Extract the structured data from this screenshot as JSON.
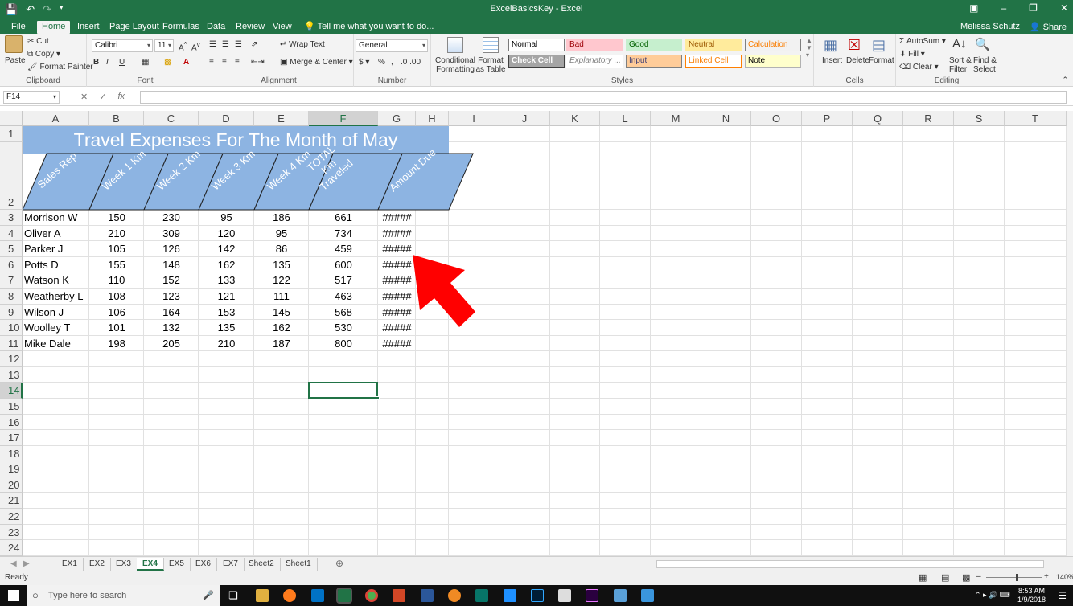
{
  "app": {
    "title": "ExcelBasicsKey - Excel",
    "user": "Melissa Schutz",
    "share": "Share"
  },
  "tabs": [
    "File",
    "Home",
    "Insert",
    "Page Layout",
    "Formulas",
    "Data",
    "Review",
    "View"
  ],
  "tell_me": "Tell me what you want to do...",
  "ribbon": {
    "clipboard": {
      "paste": "Paste",
      "cut": "Cut",
      "copy": "Copy",
      "format_painter": "Format Painter",
      "label": "Clipboard"
    },
    "font": {
      "name": "Calibri",
      "size": "11",
      "label": "Font"
    },
    "alignment": {
      "wrap": "Wrap Text",
      "merge": "Merge & Center",
      "label": "Alignment"
    },
    "number": {
      "format": "General",
      "label": "Number"
    },
    "styles": {
      "conditional": "Conditional Formatting",
      "format_table": "Format as Table",
      "label": "Styles",
      "cells": [
        {
          "name": "Normal",
          "bg": "#ffffff",
          "fg": "#000000",
          "border": "#7a7a7a"
        },
        {
          "name": "Bad",
          "bg": "#ffc7ce",
          "fg": "#9c0006",
          "border": "#ffc7ce"
        },
        {
          "name": "Good",
          "bg": "#c6efce",
          "fg": "#006100",
          "border": "#c6efce"
        },
        {
          "name": "Neutral",
          "bg": "#ffeb9c",
          "fg": "#9c5700",
          "border": "#ffeb9c"
        },
        {
          "name": "Calculation",
          "bg": "#f2f2f2",
          "fg": "#fa7d00",
          "border": "#7f7f7f"
        },
        {
          "name": "Check Cell",
          "bg": "#a5a5a5",
          "fg": "#ffffff",
          "border": "#3f3f3f"
        },
        {
          "name": "Explanatory ...",
          "bg": "#ffffff",
          "fg": "#7f7f7f",
          "border": "#ffffff"
        },
        {
          "name": "Input",
          "bg": "#ffcc99",
          "fg": "#3f3f76",
          "border": "#7f7f7f"
        },
        {
          "name": "Linked Cell",
          "bg": "#ffffff",
          "fg": "#fa7d00",
          "border": "#ff8001"
        },
        {
          "name": "Note",
          "bg": "#ffffcc",
          "fg": "#000000",
          "border": "#b2b2b2"
        }
      ]
    },
    "cells": {
      "insert": "Insert",
      "delete": "Delete",
      "format": "Format",
      "label": "Cells"
    },
    "editing": {
      "autosum": "AutoSum",
      "fill": "Fill",
      "clear": "Clear",
      "sort": "Sort & Filter",
      "find": "Find & Select",
      "label": "Editing"
    }
  },
  "formula_bar": {
    "name_box": "F14",
    "fx": "fx",
    "value": ""
  },
  "columns": [
    "A",
    "B",
    "C",
    "D",
    "E",
    "F",
    "G",
    "H",
    "I",
    "J",
    "K",
    "L",
    "M",
    "N",
    "O",
    "P",
    "Q",
    "R",
    "S",
    "T"
  ],
  "rows": [
    "1",
    "2",
    "3",
    "4",
    "5",
    "6",
    "7",
    "8",
    "9",
    "10",
    "11",
    "12",
    "13",
    "14",
    "15",
    "16",
    "17",
    "18",
    "19",
    "20",
    "21",
    "22",
    "23",
    "24"
  ],
  "sheet": {
    "title": "Travel Expenses For The Month of May",
    "headers": [
      "Sales Rep",
      "Week 1 Km",
      "Week 2 Km",
      "Week 3 Km",
      "Week 4 Km",
      "TOTAL Km Traveled",
      "Amount Due"
    ],
    "data": [
      [
        "Morrison W",
        "150",
        "230",
        "95",
        "186",
        "661",
        "#####"
      ],
      [
        "Oliver A",
        "210",
        "309",
        "120",
        "95",
        "734",
        "#####"
      ],
      [
        "Parker J",
        "105",
        "126",
        "142",
        "86",
        "459",
        "#####"
      ],
      [
        "Potts D",
        "155",
        "148",
        "162",
        "135",
        "600",
        "#####"
      ],
      [
        "Watson K",
        "110",
        "152",
        "133",
        "122",
        "517",
        "#####"
      ],
      [
        "Weatherby L",
        "108",
        "123",
        "121",
        "111",
        "463",
        "#####"
      ],
      [
        "Wilson J",
        "106",
        "164",
        "153",
        "145",
        "568",
        "#####"
      ],
      [
        "Woolley T",
        "101",
        "132",
        "135",
        "162",
        "530",
        "#####"
      ],
      [
        "Mike Dale",
        "198",
        "205",
        "210",
        "187",
        "800",
        "#####"
      ]
    ]
  },
  "sheet_tabs": [
    "EX1",
    "EX2",
    "EX3",
    "EX4",
    "EX5",
    "EX6",
    "EX7",
    "Sheet2",
    "Sheet1"
  ],
  "active_sheet": "EX4",
  "status": {
    "ready": "Ready",
    "zoom": "140%"
  },
  "taskbar": {
    "search": "Type here to search",
    "time": "8:53 AM",
    "date": "1/9/2018"
  },
  "colors": {
    "excel_green": "#217346",
    "header_blue": "#8db4e2",
    "arrow_red": "#ff0000"
  }
}
